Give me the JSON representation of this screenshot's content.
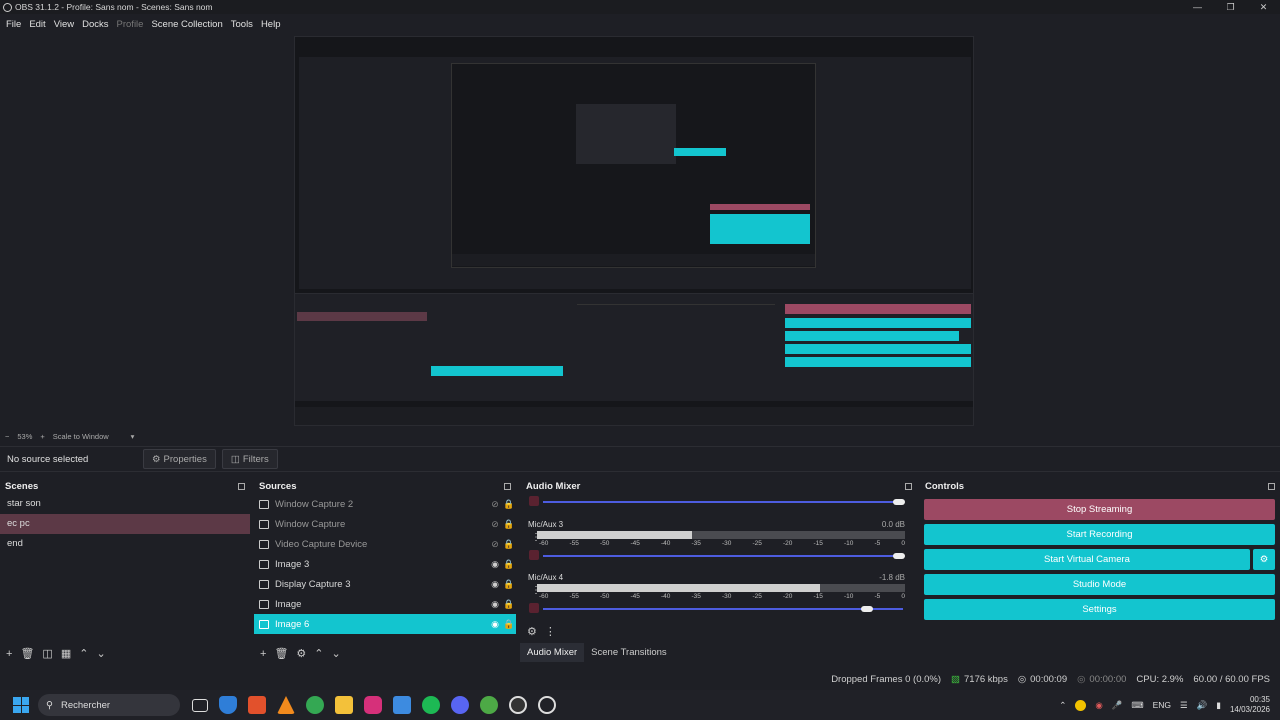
{
  "window": {
    "title": "OBS 31.1.2 - Profile: Sans nom - Scenes: Sans nom"
  },
  "menu": {
    "items": [
      "File",
      "Edit",
      "View",
      "Docks",
      "Profile",
      "Scene Collection",
      "Tools",
      "Help"
    ]
  },
  "preview": {
    "zoom": "53%",
    "scale_label": "Scale to Window"
  },
  "properties_bar": {
    "no_source": "No source selected",
    "properties_label": "Properties",
    "filters_label": "Filters"
  },
  "scenes": {
    "header": "Scenes",
    "items": [
      "star son",
      "ec pc",
      "end"
    ],
    "selected": "ec pc"
  },
  "sources": {
    "header": "Sources",
    "items": [
      {
        "name": "Window Capture 2",
        "visible": false
      },
      {
        "name": "Window Capture",
        "visible": false
      },
      {
        "name": "Video Capture Device",
        "visible": false
      },
      {
        "name": "Image 3",
        "visible": true
      },
      {
        "name": "Display Capture 3",
        "visible": true
      },
      {
        "name": "Image",
        "visible": true
      },
      {
        "name": "Image 6",
        "visible": true
      }
    ],
    "selected": "Image 6"
  },
  "mixer": {
    "header": "Audio Mixer",
    "channels": [
      {
        "name": "",
        "db": ""
      },
      {
        "name": "Mic/Aux 3",
        "db": "0.0 dB"
      },
      {
        "name": "Mic/Aux 4",
        "db": "-1.8 dB"
      }
    ],
    "ticks": [
      "-60",
      "-55",
      "-50",
      "-45",
      "-40",
      "-35",
      "-30",
      "-25",
      "-20",
      "-15",
      "-10",
      "-5",
      "0"
    ],
    "tabs": [
      "Audio Mixer",
      "Scene Transitions"
    ]
  },
  "controls": {
    "header": "Controls",
    "stop_streaming": "Stop Streaming",
    "start_recording": "Start Recording",
    "start_virtual_camera": "Start Virtual Camera",
    "studio_mode": "Studio Mode",
    "settings": "Settings"
  },
  "status": {
    "dropped_frames": "Dropped Frames 0 (0.0%)",
    "bitrate": "7176 kbps",
    "stream_time": "00:00:09",
    "rec_time": "00:00:00",
    "cpu": "CPU: 2.9%",
    "fps": "60.00 / 60.00 FPS"
  },
  "taskbar": {
    "search_label": "Rechercher",
    "lang": "ENG",
    "time": "00:35",
    "date": "14/03/2026"
  },
  "colors": {
    "stop_streaming": "#9c4963",
    "accent": "#13c5cf",
    "scene_selected": "#5c3946"
  }
}
